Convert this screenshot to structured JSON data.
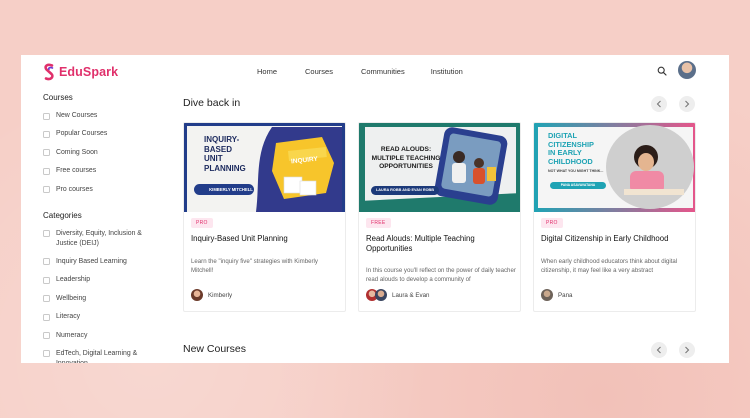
{
  "brand": {
    "name": "EduSpark",
    "color": "#e0306b"
  },
  "nav": {
    "home": "Home",
    "courses": "Courses",
    "community": "Communities",
    "institution": "Institution"
  },
  "sidebar": {
    "courses_heading": "Courses",
    "course_filters": [
      "New Courses",
      "Popular Courses",
      "Coming Soon",
      "Free courses",
      "Pro courses"
    ],
    "categories_heading": "Categories",
    "categories": [
      "Diversity, Equity, Inclusion & Justice (DEIJ)",
      "Inquiry Based Learning",
      "Leadership",
      "Wellbeing",
      "Literacy",
      "Numeracy",
      "EdTech, Digital Learning & Innovation"
    ]
  },
  "sections": {
    "dive_back": "Dive back in",
    "new_courses": "New Courses"
  },
  "cards": [
    {
      "badge": "PRO",
      "title": "Inquiry-Based Unit Planning",
      "desc": "Learn the \"inquiry five\" strategies with Kimberly Mitchell!",
      "author": "Kimberly",
      "art_title_1": "INQUIRY-",
      "art_title_2": "BASED",
      "art_title_3": "UNIT",
      "art_title_4": "PLANNING",
      "art_pill": "KIMBERLY MITCHELL",
      "art_book": "INQUIRY"
    },
    {
      "badge": "FREE",
      "title": "Read Alouds: Multiple Teaching Opportunities",
      "desc": "In this course you'll reflect on the power of daily teacher read alouds to develop a community of",
      "author": "Laura & Evan",
      "art_title_1": "READ ALOUDS:",
      "art_title_2": "MULTIPLE TEACHING",
      "art_title_3": "OPPORTUNITIES",
      "art_pill": "LAURA ROBB AND EVAN ROBB"
    },
    {
      "badge": "PRO",
      "title": "Digital Citizenship in Early Childhood",
      "desc": "When early childhood educators think about digital citizenship, it may feel like a very abstract",
      "author": "Pana",
      "art_title_1": "DIGITAL",
      "art_title_2": "CITIZENSHIP",
      "art_title_3": "IN EARLY",
      "art_title_4": "CHILDHOOD",
      "art_sub": "NOT WHAT YOU MIGHT THINK...",
      "art_pill": "PANA ASAVAVATANA"
    }
  ],
  "icons": {
    "search": "search-icon",
    "prev": "chevron-left-icon",
    "next": "chevron-right-icon",
    "checkbox": "checkbox-icon"
  },
  "colors": {
    "background": "#f6cfc7",
    "badge_bg": "#fde6ef",
    "badge_text": "#e0306b"
  }
}
